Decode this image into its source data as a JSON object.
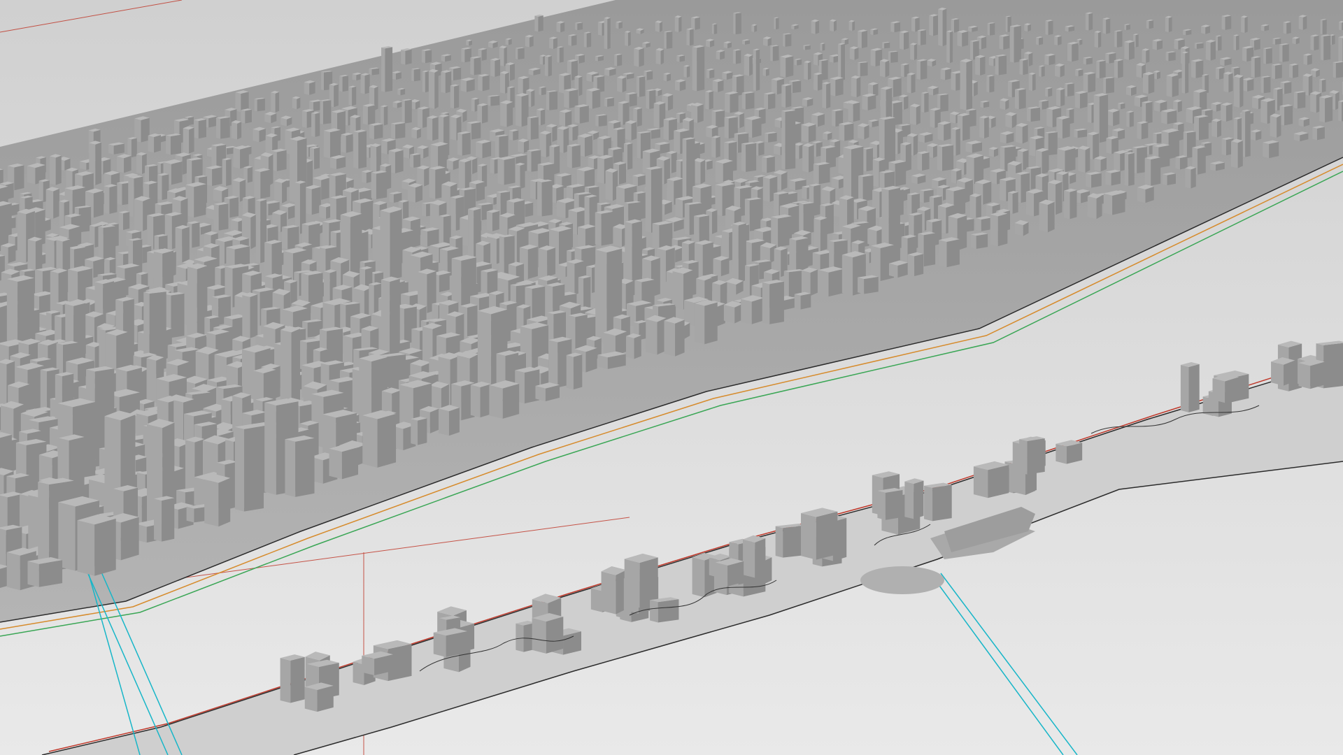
{
  "viewport": {
    "background_color": "#dcdcdc",
    "ground_color": "#e2e2e2",
    "building_light": "#b9b9b9",
    "building_mid": "#a6a6a6",
    "building_dark": "#8c8c8c"
  },
  "layers": {
    "grid_color": "#c0392b",
    "contour_color": "#2b2b2b",
    "utility_color": "#17b6c8",
    "green_color": "#3aa655",
    "orange_color": "#d68b2c"
  },
  "scene_objects": [
    {
      "name": "city-block-mainland",
      "kind": "massing"
    },
    {
      "name": "island-strip",
      "kind": "massing"
    },
    {
      "name": "river-channel",
      "kind": "water"
    },
    {
      "name": "bridge-lines",
      "kind": "infrastructure"
    }
  ]
}
